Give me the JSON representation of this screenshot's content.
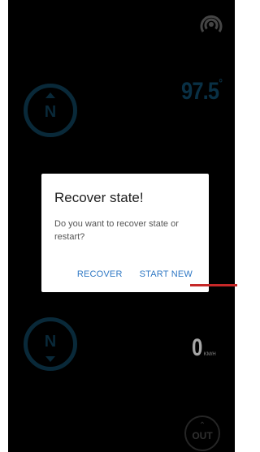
{
  "signal": {
    "icon": "radio-signal-icon"
  },
  "compass_top": {
    "label": "N",
    "icon": "compass-north-up-icon"
  },
  "compass_bottom": {
    "label": "N",
    "icon": "compass-north-down-icon"
  },
  "frequency": {
    "value": "97.5",
    "unit": "°"
  },
  "speed": {
    "value": "0",
    "unit": "KM/H"
  },
  "out_button": {
    "label": "OUT",
    "icon": "chevron-up-icon"
  },
  "dialog": {
    "title": "Recover state!",
    "message": "Do you want to recover state or restart?",
    "recover_label": "RECOVER",
    "start_new_label": "START NEW"
  },
  "colors": {
    "accent_dark": "#0f3f58",
    "dialog_button": "#2f78c4",
    "marker": "#c62828"
  }
}
